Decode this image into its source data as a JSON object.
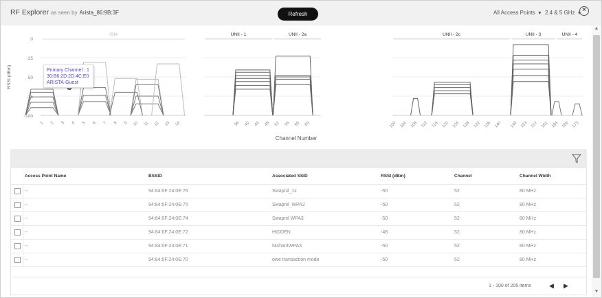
{
  "header": {
    "title": "RF Explorer",
    "subtitle": "as seen by",
    "device": "Arista_86:9B:3F",
    "refresh_label": "Refresh",
    "ap_filter": "All Access Points",
    "band_filter": "2.4 & 5 GHz"
  },
  "chart_data": {
    "type": "area",
    "ylabel": "RSSI (dBm)",
    "xlabel": "Channel Number",
    "ylim": [
      -100,
      0
    ],
    "yticks": [
      "0",
      "-25",
      "-50",
      "-75",
      "-100"
    ],
    "band_labels": [
      "ISM",
      "UNII - 1",
      "UNII - 2a",
      "UNII - 2c",
      "UNII - 3",
      "UNII - 4"
    ],
    "channels_24": [
      "1",
      "2",
      "3",
      "4",
      "5",
      "6",
      "7",
      "8",
      "9",
      "10",
      "11",
      "12",
      "13",
      "14"
    ],
    "channels_5a": [
      "36",
      "40",
      "44",
      "48",
      "52",
      "56",
      "60",
      "64"
    ],
    "channels_5c": [
      "100",
      "104",
      "108",
      "112",
      "116",
      "120",
      "124",
      "128",
      "132",
      "136",
      "140"
    ],
    "channels_5d": [
      "149",
      "153",
      "157",
      "161",
      "165",
      "169",
      "173"
    ],
    "series": [
      {
        "band": "24",
        "center": 1,
        "rssi": -76
      },
      {
        "band": "24",
        "center": 1,
        "rssi": -70
      },
      {
        "band": "24",
        "center": 1,
        "rssi": -66
      },
      {
        "band": "24",
        "center": 1,
        "rssi": -83
      },
      {
        "band": "24",
        "center": 1,
        "rssi": -90
      },
      {
        "band": "24",
        "center": 6,
        "rssi": -74
      },
      {
        "band": "24",
        "center": 6,
        "rssi": -64
      },
      {
        "band": "24",
        "center": 6,
        "rssi": -82
      },
      {
        "band": "24",
        "center": 6,
        "rssi": -31
      },
      {
        "band": "24",
        "center": 9,
        "rssi": -52
      },
      {
        "band": "24",
        "center": 9,
        "rssi": -70
      },
      {
        "band": "24",
        "center": 11,
        "rssi": -53
      },
      {
        "band": "24",
        "center": 11,
        "rssi": -60
      },
      {
        "band": "24",
        "center": 11,
        "rssi": -75
      },
      {
        "band": "24",
        "center": 11,
        "rssi": -85
      },
      {
        "band": "24",
        "center": 13,
        "rssi": -33
      },
      {
        "band": "5a",
        "lo": 36,
        "hi": 48,
        "rssi": -41
      },
      {
        "band": "5a",
        "lo": 36,
        "hi": 48,
        "rssi": -44
      },
      {
        "band": "5a",
        "lo": 36,
        "hi": 48,
        "rssi": -48
      },
      {
        "band": "5a",
        "lo": 36,
        "hi": 48,
        "rssi": -52
      },
      {
        "band": "5a",
        "lo": 36,
        "hi": 48,
        "rssi": -56
      },
      {
        "band": "5a",
        "lo": 36,
        "hi": 48,
        "rssi": -61
      },
      {
        "band": "5a",
        "lo": 36,
        "hi": 48,
        "rssi": -66
      },
      {
        "band": "5a",
        "lo": 52,
        "hi": 64,
        "rssi": -23
      },
      {
        "band": "5a",
        "lo": 52,
        "hi": 64,
        "rssi": -48
      },
      {
        "band": "5a",
        "lo": 52,
        "hi": 64,
        "rssi": -50
      },
      {
        "band": "5a",
        "lo": 52,
        "hi": 64,
        "rssi": -53
      },
      {
        "band": "5a",
        "lo": 52,
        "hi": 64,
        "rssi": -60
      },
      {
        "band": "5c",
        "lo": 108,
        "hi": 108,
        "rssi": -78
      },
      {
        "band": "5c",
        "lo": 116,
        "hi": 128,
        "rssi": -57
      },
      {
        "band": "5c",
        "lo": 116,
        "hi": 128,
        "rssi": -60
      },
      {
        "band": "5c",
        "lo": 116,
        "hi": 128,
        "rssi": -64
      },
      {
        "band": "5c",
        "lo": 116,
        "hi": 128,
        "rssi": -68
      },
      {
        "band": "5c",
        "lo": 116,
        "hi": 128,
        "rssi": -72
      },
      {
        "band": "5d",
        "lo": 149,
        "hi": 161,
        "rssi": -8
      },
      {
        "band": "5d",
        "lo": 149,
        "hi": 161,
        "rssi": -22
      },
      {
        "band": "5d",
        "lo": 149,
        "hi": 161,
        "rssi": -28
      },
      {
        "band": "5d",
        "lo": 149,
        "hi": 161,
        "rssi": -33
      },
      {
        "band": "5d",
        "lo": 149,
        "hi": 161,
        "rssi": -40
      },
      {
        "band": "5d",
        "lo": 149,
        "hi": 161,
        "rssi": -48
      },
      {
        "band": "5d",
        "lo": 149,
        "hi": 161,
        "rssi": -56
      },
      {
        "band": "5d",
        "lo": 165,
        "hi": 165,
        "rssi": -82
      },
      {
        "band": "5d",
        "lo": 173,
        "hi": 173,
        "rssi": -85
      }
    ]
  },
  "tooltip": {
    "line1": "Primary Channel : 1",
    "line2": "30:B6:2D:2D:4C:E0",
    "line3": "ARISTA-Guest"
  },
  "table": {
    "columns": [
      "Access Point Name",
      "BSSID",
      "Associated SSID",
      "RSSI (dBm)",
      "Channel",
      "Channel Width"
    ],
    "rows": [
      [
        "--",
        "94:84:0F:24:0E:76",
        "Swapnil_1x",
        "-50",
        "52",
        "80 MHz"
      ],
      [
        "--",
        "94:84:0F:24:0E:75",
        "Swapnil_WPA2",
        "-50",
        "52",
        "80 MHz"
      ],
      [
        "--",
        "94:84:0F:24:0E:74",
        "Swapnil WPA3",
        "-50",
        "52",
        "80 MHz"
      ],
      [
        "--",
        "94:84:0F:24:0E:72",
        "HIDDEN",
        "-48",
        "52",
        "80 MHz"
      ],
      [
        "--",
        "94:84:0F:24:0E:71",
        "NishantWPA3",
        "-50",
        "52",
        "80 MHz"
      ],
      [
        "--",
        "94:84:0F:24:0E:70",
        "owe transaction mode",
        "-50",
        "52",
        "80 MHz"
      ]
    ]
  },
  "pager": {
    "info": "1 - 100 of 205 items"
  }
}
